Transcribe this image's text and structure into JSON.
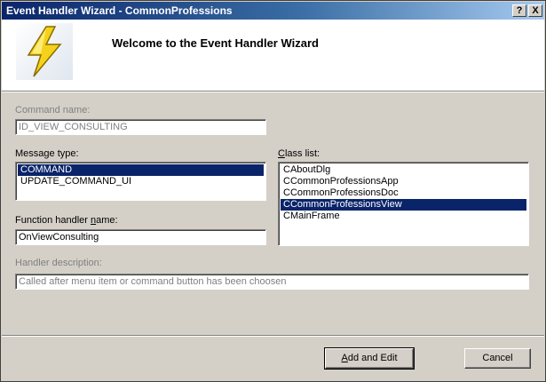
{
  "window": {
    "title": "Event Handler Wizard - CommonProfessions",
    "help_glyph": "?",
    "close_glyph": "X"
  },
  "header": {
    "title": "Welcome to the Event Handler Wizard",
    "logo_icon": "lightning-bolt-icon"
  },
  "command_name": {
    "label": "Command name:",
    "value": "ID_VIEW_CONSULTING"
  },
  "message_type": {
    "label": "Message type:",
    "items": [
      "COMMAND",
      "UPDATE_COMMAND_UI"
    ],
    "selected": 0
  },
  "class_list": {
    "label_pre": "",
    "label_accel": "C",
    "label_post": "lass list:",
    "items": [
      "CAboutDlg",
      "CCommonProfessionsApp",
      "CCommonProfessionsDoc",
      "CCommonProfessionsView",
      "CMainFrame"
    ],
    "selected": 3
  },
  "function_handler": {
    "label_pre": "Function handler ",
    "label_accel": "n",
    "label_post": "ame:",
    "value": "OnViewConsulting"
  },
  "handler_description": {
    "label": "Handler description:",
    "value": "Called after menu item or command button has been choosen"
  },
  "buttons": {
    "add_pre": "",
    "add_accel": "A",
    "add_post": "dd and Edit",
    "cancel": "Cancel"
  },
  "colors": {
    "selection": "#0a246a",
    "face": "#d4d0c8",
    "disabled_text": "#808080"
  }
}
